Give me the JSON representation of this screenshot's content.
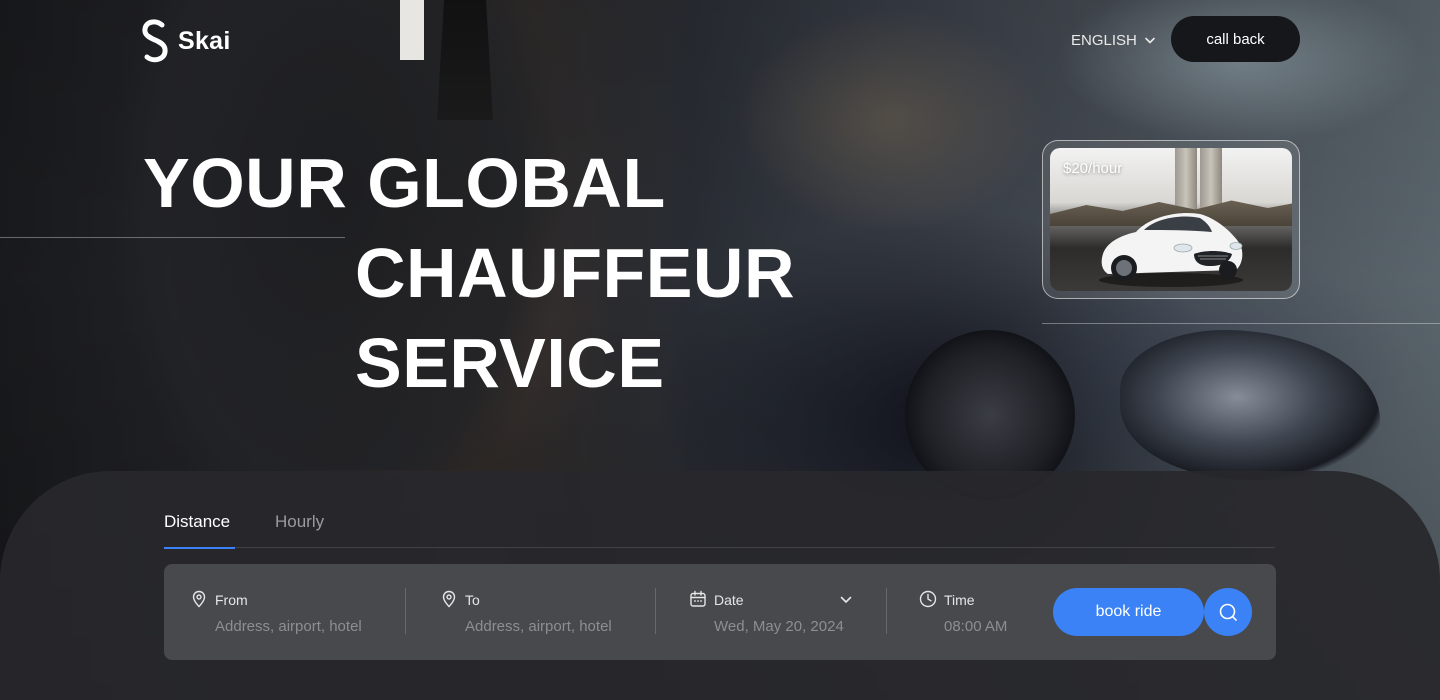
{
  "brand": {
    "name": "Skai"
  },
  "header": {
    "language": "ENGLISH",
    "callback_label": "call back"
  },
  "hero": {
    "headline": [
      "YOUR GLOBAL",
      "CHAUFFEUR",
      "SERVICE"
    ]
  },
  "price_card": {
    "label": "$20/hour"
  },
  "booking": {
    "tabs": [
      {
        "label": "Distance",
        "active": true
      },
      {
        "label": "Hourly",
        "active": false
      }
    ],
    "fields": {
      "from": {
        "label": "From",
        "placeholder": "Address, airport, hotel"
      },
      "to": {
        "label": "To",
        "placeholder": "Address, airport, hotel"
      },
      "date": {
        "label": "Date",
        "value": "Wed, May 20, 2024"
      },
      "time": {
        "label": "Time",
        "value": "08:00 AM"
      }
    },
    "book_label": "book ride"
  },
  "icons": {
    "logo": "skai-logo-icon",
    "language_chevron": "chevron-down-icon",
    "from": "location-pin-icon",
    "to": "location-pin-icon",
    "date": "calendar-icon",
    "date_chevron": "chevron-down-icon",
    "time": "clock-icon",
    "search": "search-icon"
  },
  "colors": {
    "accent": "#3b82f6",
    "callback_bg": "#15171b",
    "panel_bg": "#28282c",
    "form_bg": "#48494d"
  }
}
